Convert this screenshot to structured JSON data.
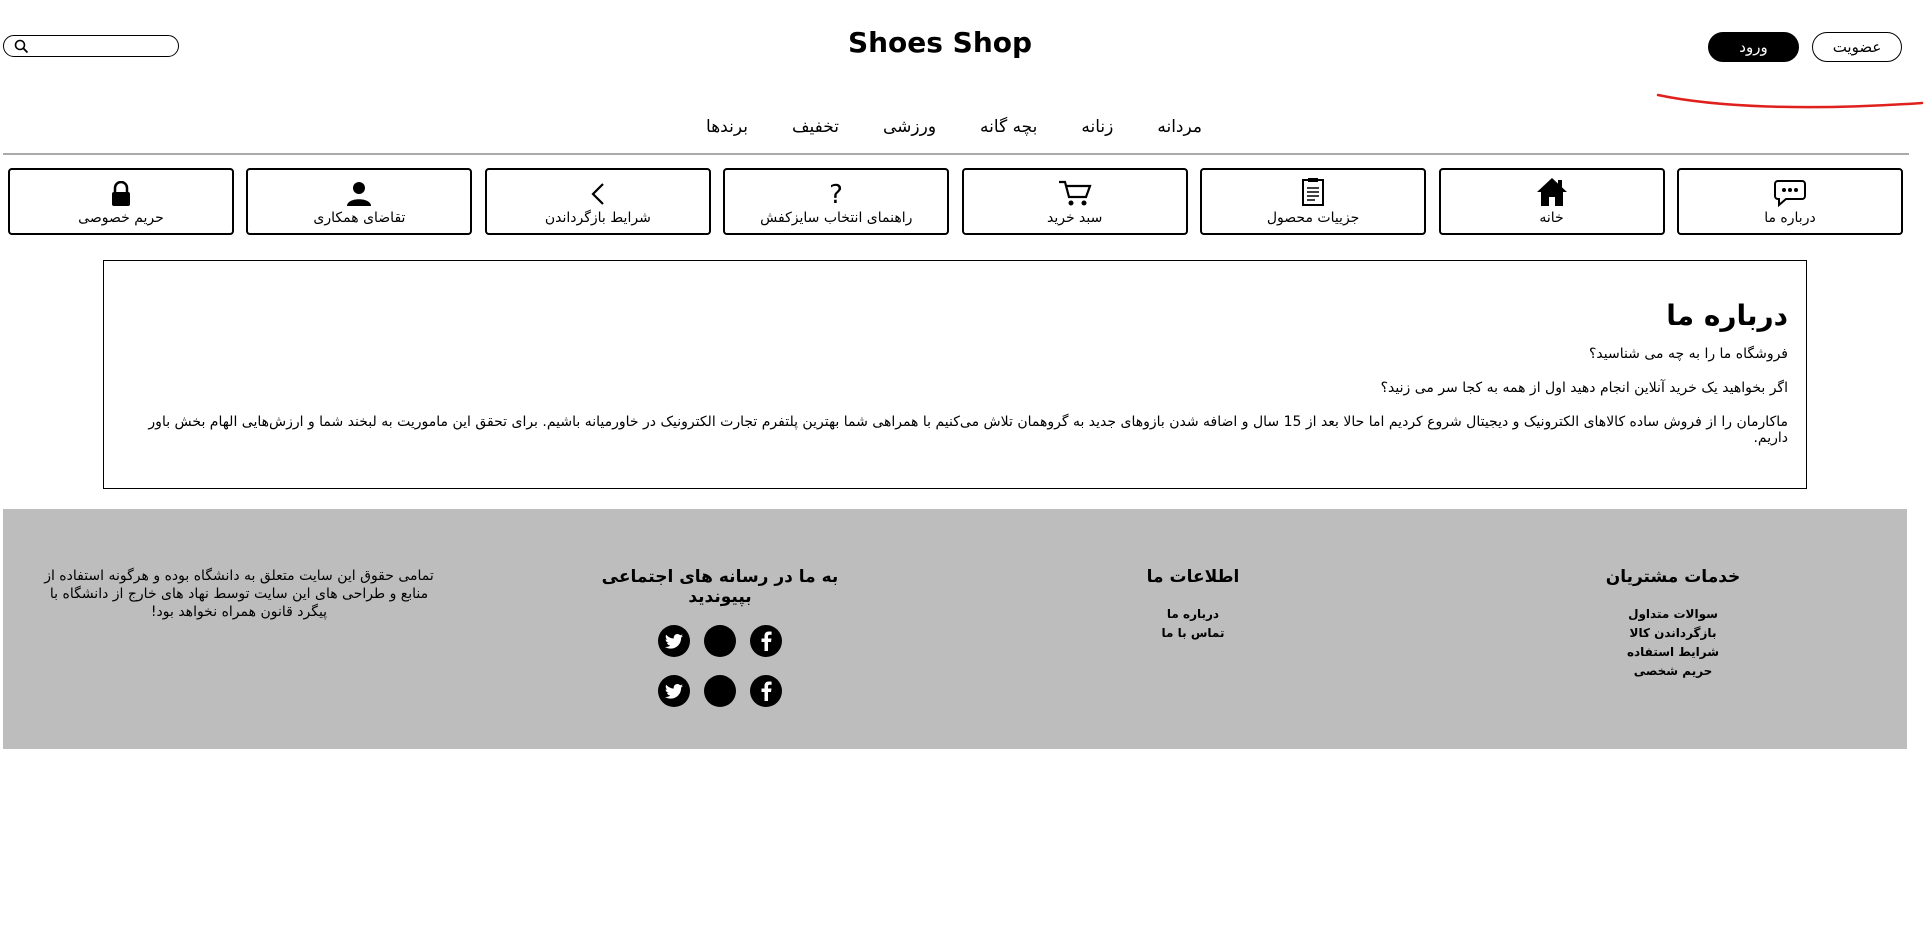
{
  "header": {
    "title": "Shoes Shop",
    "search_placeholder": "",
    "login_label": "ورود",
    "register_label": "عضویت"
  },
  "categories": [
    "مردانه",
    "زنانه",
    "بچه گانه",
    "ورزشی",
    "تخفیف",
    "برندها"
  ],
  "tiles": [
    {
      "label": "درباره ما",
      "icon": "chat-icon"
    },
    {
      "label": "خانه",
      "icon": "home-icon"
    },
    {
      "label": "جزییات محصول",
      "icon": "document-icon"
    },
    {
      "label": "سبد خرید",
      "icon": "cart-icon"
    },
    {
      "label": "راهنمای انتخاب سایزکفش",
      "icon": "question-icon"
    },
    {
      "label": "شرایط بازگرداندن",
      "icon": "chevron-left-icon"
    },
    {
      "label": "تقاضای همکاری",
      "icon": "user-icon"
    },
    {
      "label": "حریم خصوصی",
      "icon": "lock-icon"
    }
  ],
  "about": {
    "title": "درباره ما",
    "paragraphs": [
      "فروشگاه ما را به چه می شناسید؟",
      "اگر بخواهید یک خرید آنلاین انجام دهید اول از همه به کجا سر می زنید؟",
      "ماکارمان را از فروش ساده کالاهای الکترونیک و دیجیتال شروع کردیم اما حالا بعد از 15 سال و اضافه شدن بازوهای جدید به گروهمان تلاش می‌کنیم با همراهی شما بهترین پلتفرم تجارت الکترونیک در خاورمیانه باشیم. برای تحقق این ماموریت به لبخند شما و ارزش‌هایی الهام بخش باور داریم."
    ]
  },
  "footer": {
    "customer_services": {
      "title": "خدمات مشتریان",
      "links": [
        "سوالات متداول",
        "بازگرداندن کالا",
        "شرایط استفاده",
        "حریم شخصی"
      ]
    },
    "info": {
      "title": "اطلاعات ما",
      "links": [
        "درباره ما",
        "تماس با ما"
      ]
    },
    "social": {
      "title": "به ما در رسانه های اجتماعی بپیوندید",
      "rows": [
        [
          "facebook-icon",
          "google-plus-icon",
          "twitter-icon"
        ],
        [
          "facebook-icon",
          "google-plus-icon",
          "twitter-icon"
        ]
      ]
    },
    "copyright": "تمامی حقوق این سایت متعلق به دانشگاه بوده و هرگونه استفاده از منابع و طراحی های این سایت توسط نهاد های خارج از دانشگاه با پیگرد قانون همراه نخواهد بود!"
  },
  "colors": {
    "footer_bg": "#bdbdbd",
    "nav_rule": "#aaaaaa",
    "annotation_stroke": "#e0201c",
    "primary_button": "#000000"
  }
}
